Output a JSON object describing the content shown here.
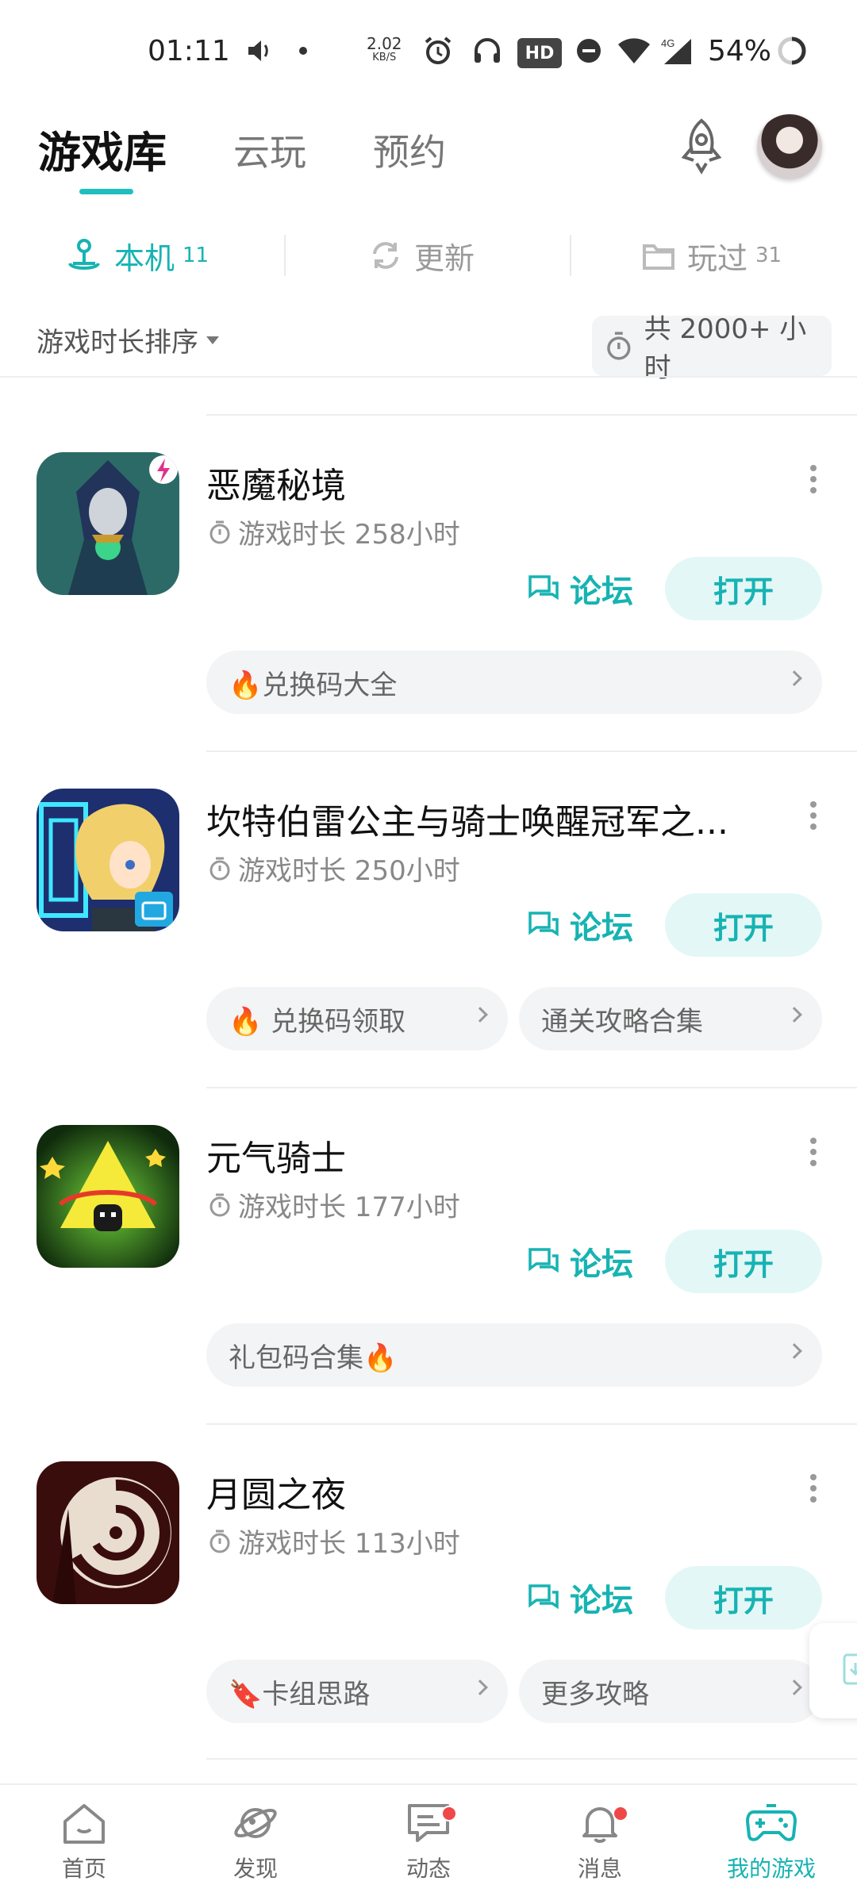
{
  "status_bar": {
    "time": "01:11",
    "net_speed_value": "2.02",
    "net_speed_unit": "KB/S",
    "hd_label": "HD",
    "network_label": "4G",
    "battery": "54%"
  },
  "header": {
    "tabs": [
      {
        "label": "游戏库",
        "active": true
      },
      {
        "label": "云玩",
        "active": false
      },
      {
        "label": "预约",
        "active": false
      }
    ]
  },
  "sub_tabs": [
    {
      "label": "本机",
      "count": "11",
      "icon": "joystick-icon",
      "active": true
    },
    {
      "label": "更新",
      "count": "",
      "icon": "refresh-icon",
      "active": false
    },
    {
      "label": "玩过",
      "count": "31",
      "icon": "folder-icon",
      "active": false
    }
  ],
  "sort": {
    "label": "游戏时长排序",
    "total": "共 2000+ 小时"
  },
  "games": [
    {
      "name": "恶魔秘境",
      "playtime": "游戏时长 258小时",
      "forum_label": "论坛",
      "open_label": "打开",
      "pills": [
        {
          "text": "🔥兑换码大全"
        }
      ]
    },
    {
      "name": "坎特伯雷公主与骑士唤醒冠军之...",
      "playtime": "游戏时长 250小时",
      "forum_label": "论坛",
      "open_label": "打开",
      "pills": [
        {
          "text": "🔥 兑换码领取"
        },
        {
          "text": "通关攻略合集"
        }
      ]
    },
    {
      "name": "元气骑士",
      "playtime": "游戏时长 177小时",
      "forum_label": "论坛",
      "open_label": "打开",
      "pills": [
        {
          "text": "礼包码合集🔥"
        }
      ]
    },
    {
      "name": "月圆之夜",
      "playtime": "游戏时长 113小时",
      "forum_label": "论坛",
      "open_label": "打开",
      "pills": [
        {
          "text": "🔖卡组思路"
        },
        {
          "text": "更多攻略"
        }
      ]
    }
  ],
  "bottom_nav": [
    {
      "label": "首页",
      "icon": "home-icon",
      "active": false,
      "badge": false
    },
    {
      "label": "发现",
      "icon": "planet-icon",
      "active": false,
      "badge": false
    },
    {
      "label": "动态",
      "icon": "chat-icon",
      "active": false,
      "badge": true
    },
    {
      "label": "消息",
      "icon": "bell-icon",
      "active": false,
      "badge": true
    },
    {
      "label": "我的游戏",
      "icon": "gamepad-icon",
      "active": true,
      "badge": false
    }
  ],
  "colors": {
    "accent": "#17b3b3",
    "open_button_bg": "#e4f7f7",
    "pill_bg": "#f3f4f5",
    "badge_red": "#f04848"
  }
}
